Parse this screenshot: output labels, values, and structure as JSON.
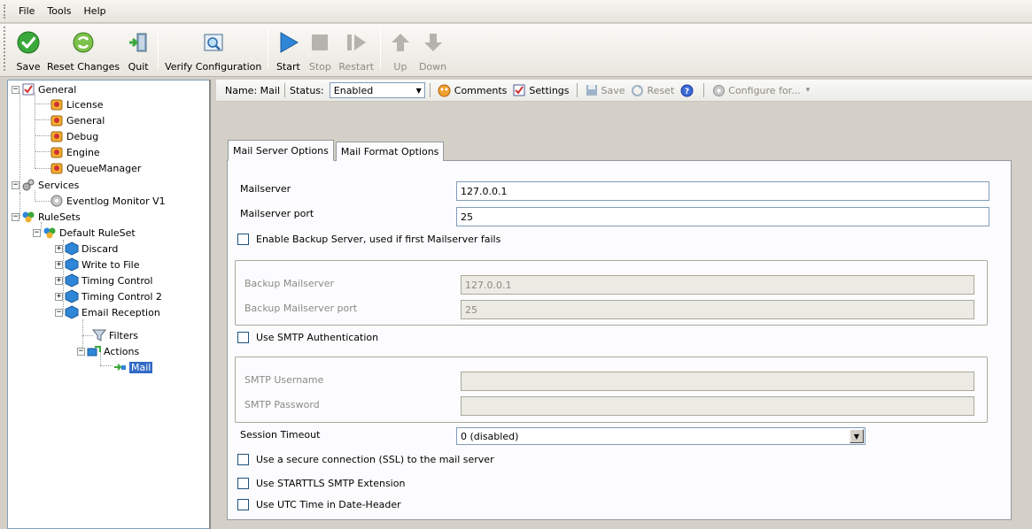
{
  "menu": [
    "File",
    "Tools",
    "Help"
  ],
  "toolbar": {
    "buttons": [
      {
        "label": "Save",
        "enabled": true
      },
      {
        "label": "Reset Changes",
        "enabled": true
      },
      {
        "label": "Quit",
        "enabled": true
      },
      {
        "label": "Verify Configuration",
        "enabled": true
      },
      {
        "label": "Start",
        "enabled": true
      },
      {
        "label": "Stop",
        "enabled": false
      },
      {
        "label": "Restart",
        "enabled": false
      },
      {
        "label": "Up",
        "enabled": false
      },
      {
        "label": "Down",
        "enabled": false
      }
    ]
  },
  "tree": {
    "general": "General",
    "license": "License",
    "general_child": "General",
    "debug": "Debug",
    "engine": "Engine",
    "queue_manager": "QueueManager",
    "services": "Services",
    "eventlog_monitor": "Eventlog Monitor V1",
    "rulesets": "RuleSets",
    "default_ruleset": "Default RuleSet",
    "discard": "Discard",
    "write_to_file": "Write to File",
    "timing_control": "Timing Control",
    "timing_control_2": "Timing Control 2",
    "email_reception": "Email Reception",
    "filters": "Filters",
    "actions": "Actions",
    "mail": "Mail"
  },
  "infobar": {
    "name": "Name: Mail",
    "status_label": "Status:",
    "status_value": "Enabled",
    "comments": "Comments",
    "settings": "Settings",
    "save": "Save",
    "reset": "Reset",
    "configure_for": "Configure for...",
    "configure_arrow": "▾"
  },
  "tabs": {
    "mail_server_options": "Mail Server Options",
    "mail_format_options": "Mail Format Options"
  },
  "form": {
    "mailserver_label": "Mailserver",
    "mailserver_value": "127.0.0.1",
    "mailserver_port_label": "Mailserver port",
    "mailserver_port_value": "25",
    "enable_backup_label": "Enable Backup Server, used if first Mailserver fails",
    "backup_mailserver_label": "Backup Mailserver",
    "backup_mailserver_value": "127.0.0.1",
    "backup_port_label": "Backup Mailserver port",
    "backup_port_value": "25",
    "use_smtp_auth_label": "Use SMTP Authentication",
    "smtp_username_label": "SMTP Username",
    "smtp_username_value": "",
    "smtp_password_label": "SMTP Password",
    "smtp_password_value": "",
    "session_timeout_label": "Session Timeout",
    "session_timeout_value": "0 (disabled)",
    "ssl_label": "Use a secure connection (SSL) to the mail server",
    "starttls_label": "Use STARTTLS SMTP Extension",
    "utc_label": "Use UTC Time in Date-Header"
  },
  "colors": {
    "selection": "#316ac5",
    "window_bg": "#d4d0c8"
  }
}
